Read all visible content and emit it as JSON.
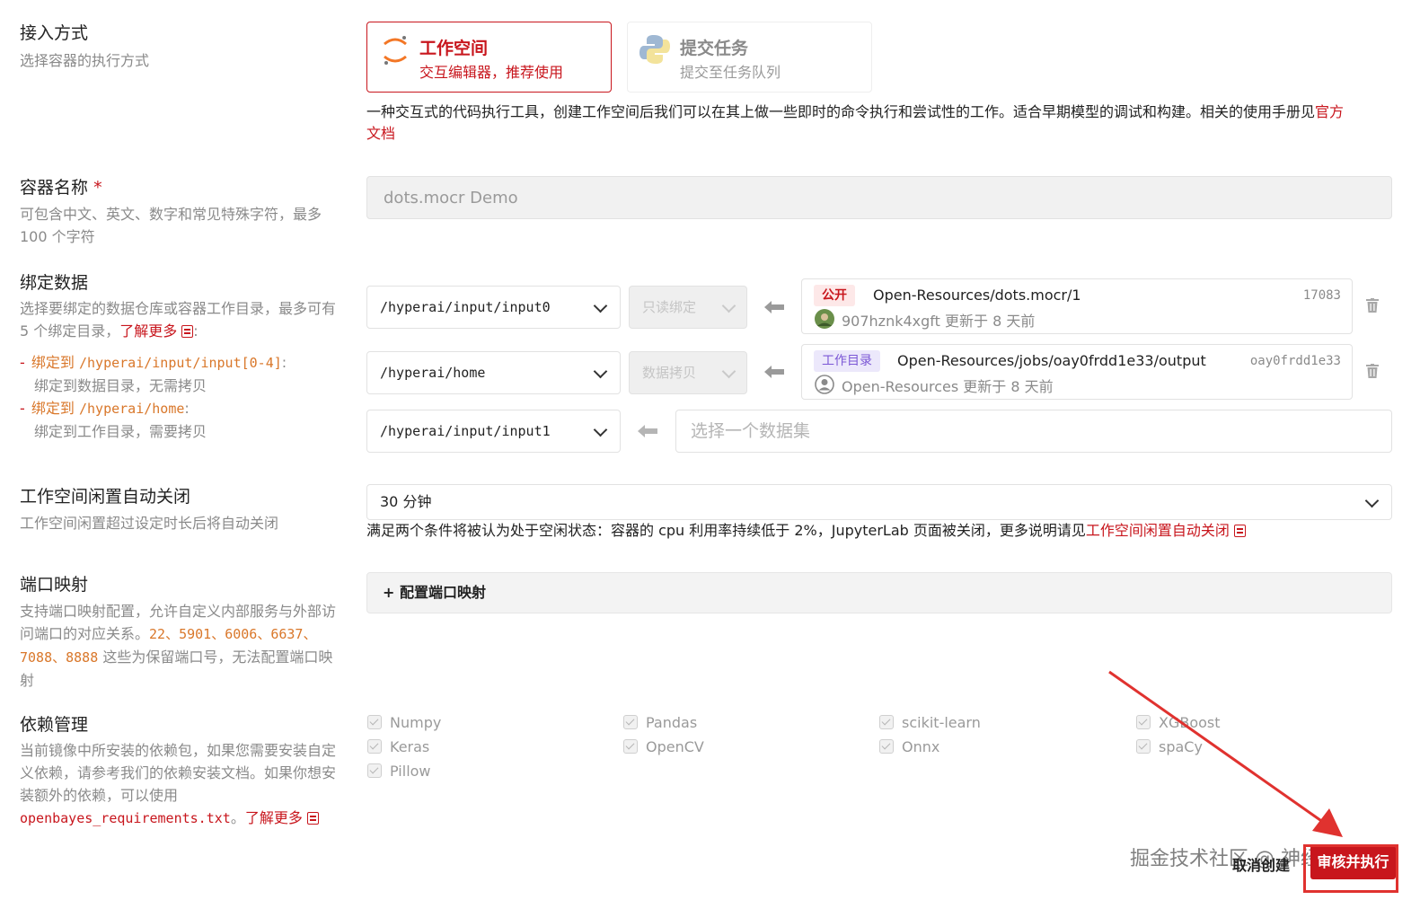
{
  "access_mode": {
    "title": "接入方式",
    "desc": "选择容器的执行方式",
    "options": [
      {
        "title": "工作空间",
        "subtitle": "交互编辑器，推荐使用"
      },
      {
        "title": "提交任务",
        "subtitle": "提交至任务队列"
      }
    ],
    "description_text": "一种交互式的代码执行工具，创建工作空间后我们可以在其上做一些即时的命令执行和尝试性的工作。适合早期模型的调试和构建。相关的使用手册见",
    "description_link_1": "官方",
    "description_link_2": "文档"
  },
  "container_name": {
    "title": "容器名称",
    "required_mark": "*",
    "desc_line1": "可包含中文、英文、数字和常见特殊字符，最多",
    "desc_line2": "100 个字符",
    "value": "dots.mocr Demo"
  },
  "bind_data": {
    "title": "绑定数据",
    "desc_line1": "选择要绑定的数据仓库或容器工作目录，最多可有",
    "desc_line2a": "5 个绑定目录，",
    "desc_link": "了解更多",
    "desc_line2b": ":",
    "rule1_prefix": "绑定到",
    "rule1_path": "/hyperai/input/input[0-4]",
    "rule1_colon": ":",
    "rule1_desc": "绑定到数据目录，无需拷贝",
    "rule2_prefix": "绑定到",
    "rule2_path": "/hyperai/home",
    "rule2_colon": ":",
    "rule2_desc": "绑定到工作目录，需要拷贝",
    "rows": [
      {
        "path": "/hyperai/input/input0",
        "mode": "只读绑定",
        "tag": "公开",
        "name": "Open-Resources/dots.mocr/1",
        "id": "17083",
        "meta": "907hznk4xgft 更新于 8 天前"
      },
      {
        "path": "/hyperai/home",
        "mode": "数据拷贝",
        "tag": "工作目录",
        "name": "Open-Resources/jobs/oay0frdd1e33/output",
        "id": "oay0frdd1e33",
        "meta": "Open-Resources 更新于 8 天前"
      },
      {
        "path": "/hyperai/input/input1",
        "placeholder": "选择一个数据集"
      }
    ]
  },
  "idle_shutdown": {
    "title": "工作空间闲置自动关闭",
    "desc": "工作空间闲置超过设定时长后将自动关闭",
    "value": "30 分钟",
    "note": "满足两个条件将被认为处于空闲状态：容器的 cpu 利用率持续低于 2%，JupyterLab 页面被关闭，更多说明请见",
    "note_link": "工作空间闲置自动关闭"
  },
  "port_mapping": {
    "title": "端口映射",
    "desc_line1": "支持端口映射配置，允许自定义内部服务与外部访",
    "desc_line2a": "问端口的对应关系。",
    "ports_line2": "22、5901、6006、6637、",
    "ports_line3": "7088、8888",
    "desc_line3b": " 这些为保留端口号，无法配置端口映",
    "desc_line4": "射",
    "button": "+ 配置端口映射"
  },
  "dependencies": {
    "title": "依赖管理",
    "desc_line1": "当前镜像中所安装的依赖包，如果您需要安装自定",
    "desc_line2": "义依赖，请参考我们的依赖安装文档。如果你想安",
    "desc_line3": "装额外的依赖，可以使用",
    "desc_file": "openbayes_requirements.txt",
    "desc_sep": "。",
    "desc_link": "了解更多",
    "packages": [
      "Numpy",
      "Pandas",
      "scikit-learn",
      "XGBoost",
      "Keras",
      "OpenCV",
      "Onnx",
      "spaCy",
      "Pillow"
    ]
  },
  "footer": {
    "cancel": "取消创建",
    "submit": "审核并执行",
    "watermark": "掘金技术社区 @ 神经星星"
  },
  "colors": {
    "accent": "#c8161d",
    "tag_public_bg": "#fde8e8",
    "tag_workdir_bg": "#ece8fb",
    "tag_workdir_fg": "#7b57d6"
  }
}
